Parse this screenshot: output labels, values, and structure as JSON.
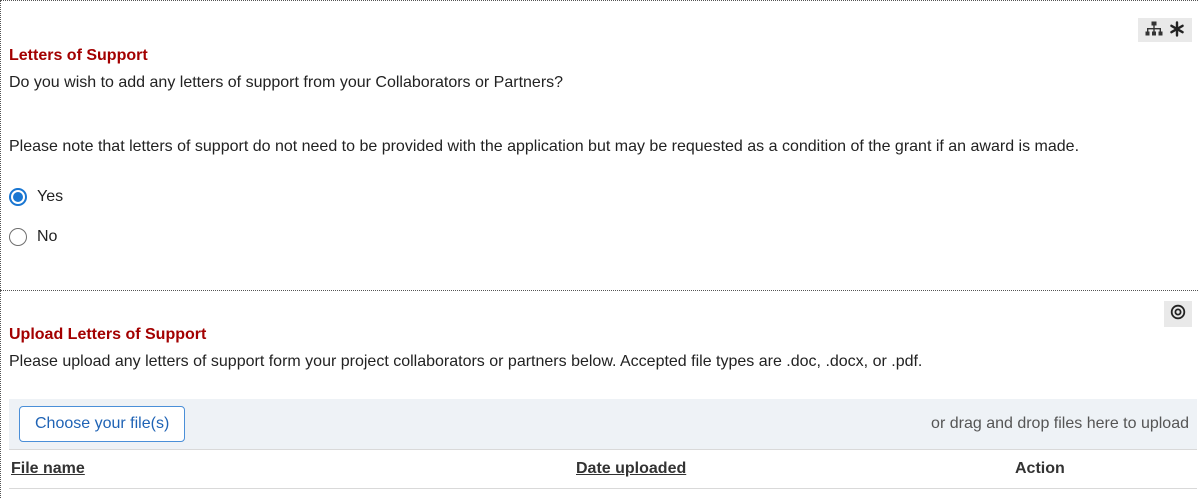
{
  "letters_question": {
    "title": "Letters of Support",
    "question": "Do you wish to add any letters of support from your Collaborators or Partners?",
    "note": "Please note that letters of support do not need to be provided with the application but may be requested as a condition of the grant if an award is made.",
    "options": [
      {
        "label": "Yes",
        "selected": true
      },
      {
        "label": "No",
        "selected": false
      }
    ],
    "icons": [
      "hierarchy-icon",
      "required-asterisk-icon"
    ]
  },
  "upload_section": {
    "title": "Upload Letters of Support",
    "instructions": "Please upload any letters of support form your project collaborators or partners below. Accepted file types are .doc, .docx, or .pdf.",
    "choose_button": "Choose your file(s)",
    "drag_drop_text": "or drag and drop files here to upload",
    "icons": [
      "target-icon"
    ],
    "table": {
      "columns": [
        "File name",
        "Date uploaded",
        "Action"
      ]
    }
  },
  "colors": {
    "title_red": "#a30000",
    "accent_blue": "#1976d2",
    "upload_bar_bg": "#eef2f6"
  }
}
